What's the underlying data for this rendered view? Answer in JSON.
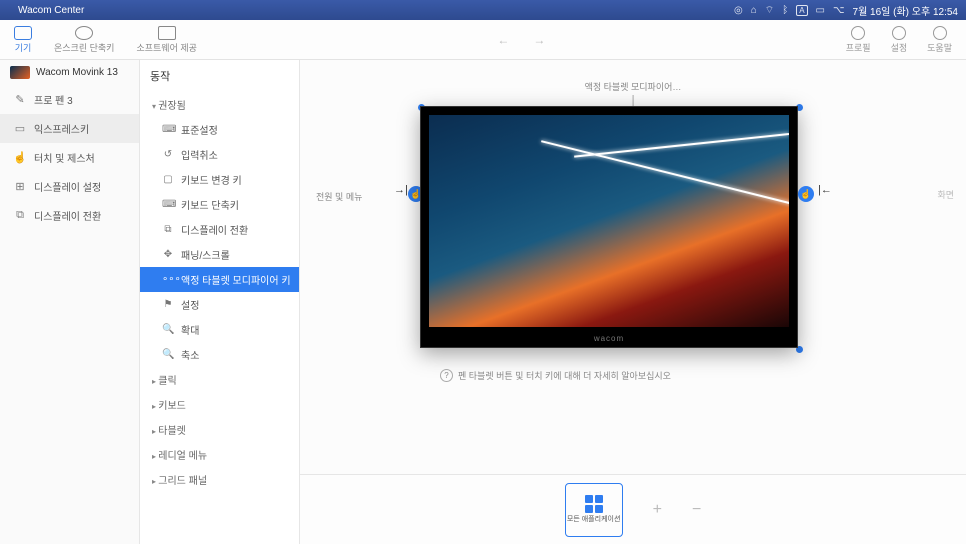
{
  "menubar": {
    "app": "Wacom Center",
    "clock": "7월 16일 (화) 오후 12:54"
  },
  "topbar": {
    "tab_device": "기기",
    "tab_onscreen": "온스크린 단축키",
    "tab_software": "소프트웨어 제공",
    "right_profile": "프로필",
    "right_settings": "설정",
    "right_help": "도움말"
  },
  "sb1": {
    "device": "Wacom Movink 13",
    "pen": "프로 펜 3",
    "express": "익스프레스키",
    "touch": "터치 및 제스처",
    "display_settings": "디스플레이 설정",
    "display_switch": "디스플레이 전환"
  },
  "sb2": {
    "title": "동작",
    "grp_recommended": "권장됨",
    "standard": "표준설정",
    "undo": "입력취소",
    "kbchange": "키보드 변경 키",
    "kbshort": "키보드 단축키",
    "dispswitch": "디스플레이 전환",
    "panscroll": "패닝/스크롤",
    "modifier": "액정 타블렛 모디파이어 키",
    "settings": "설정",
    "zoomin": "확대",
    "zoomout": "축소",
    "grp_click": "클릭",
    "grp_keyboard": "키보드",
    "grp_tablet": "타블렛",
    "grp_radial": "레디얼 메뉴",
    "grp_grid": "그리드 패널"
  },
  "content": {
    "top_label": "액정 타블렛 모디파이어…",
    "left_label": "전원 및 메뉴",
    "right_label": "화면",
    "tablet_brand": "wacom",
    "tip": "펜 타블렛 버튼 및 터치 키에 대해 더 자세히 알아보십시오"
  },
  "appbar": {
    "all_apps": "모든\n애플리케이션"
  }
}
